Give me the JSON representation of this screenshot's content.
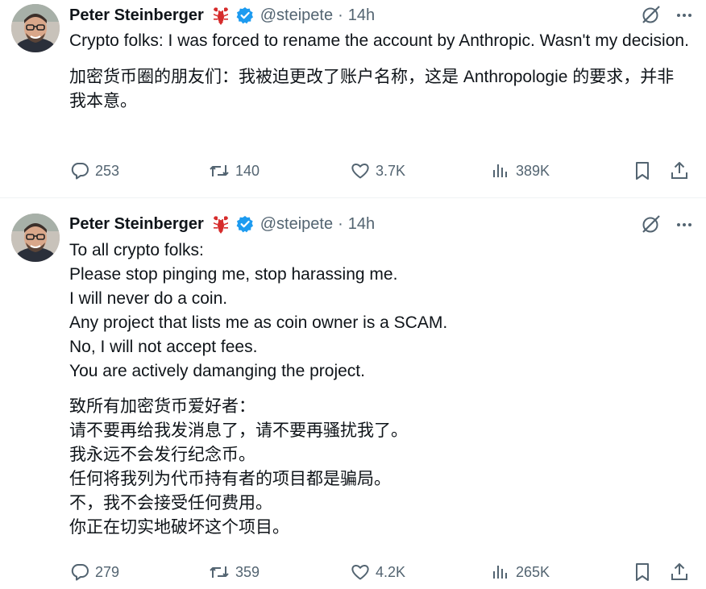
{
  "tweets": [
    {
      "author_name": "Peter Steinberger",
      "handle": "@steipete",
      "separator": "·",
      "time": "14h",
      "paragraphs": [
        [
          "Crypto folks: I was forced to rename the account by Anthropic. Wasn't my decision."
        ],
        [
          "加密货币圈的朋友们：我被迫更改了账户名称，这是 Anthropologie 的要求，并非我本意。"
        ]
      ],
      "stats": {
        "replies": "253",
        "reposts": "140",
        "likes": "3.7K",
        "views": "389K"
      }
    },
    {
      "author_name": "Peter Steinberger",
      "handle": "@steipete",
      "separator": "·",
      "time": "14h",
      "paragraphs": [
        [
          "To all crypto folks:",
          "Please stop pinging me, stop harassing me.",
          "I will never do a coin.",
          "Any project that lists me as coin owner is a SCAM.",
          "No, I will not accept fees.",
          "You are actively damanging the project."
        ],
        [
          "致所有加密货币爱好者：",
          "请不要再给我发消息了，请不要再骚扰我了。",
          "我永远不会发行纪念币。",
          "任何将我列为代币持有者的项目都是骗局。",
          "不，我不会接受任何费用。",
          "你正在切实地破坏这个项目。"
        ]
      ],
      "stats": {
        "replies": "279",
        "reposts": "359",
        "likes": "4.2K",
        "views": "265K"
      }
    }
  ],
  "colors": {
    "text": "#0f1419",
    "muted": "#536471",
    "verified": "#1d9bf0",
    "lobster": "#d62c2c",
    "divider": "#eff3f4"
  },
  "icons": {
    "reply": "reply-icon",
    "repost": "repost-icon",
    "like": "heart-icon",
    "views": "views-chart-icon",
    "bookmark": "bookmark-icon",
    "share": "share-icon",
    "grok": "grok-icon",
    "more": "more-icon",
    "lobster": "lobster-emoji-icon",
    "verified": "verified-badge-icon"
  }
}
